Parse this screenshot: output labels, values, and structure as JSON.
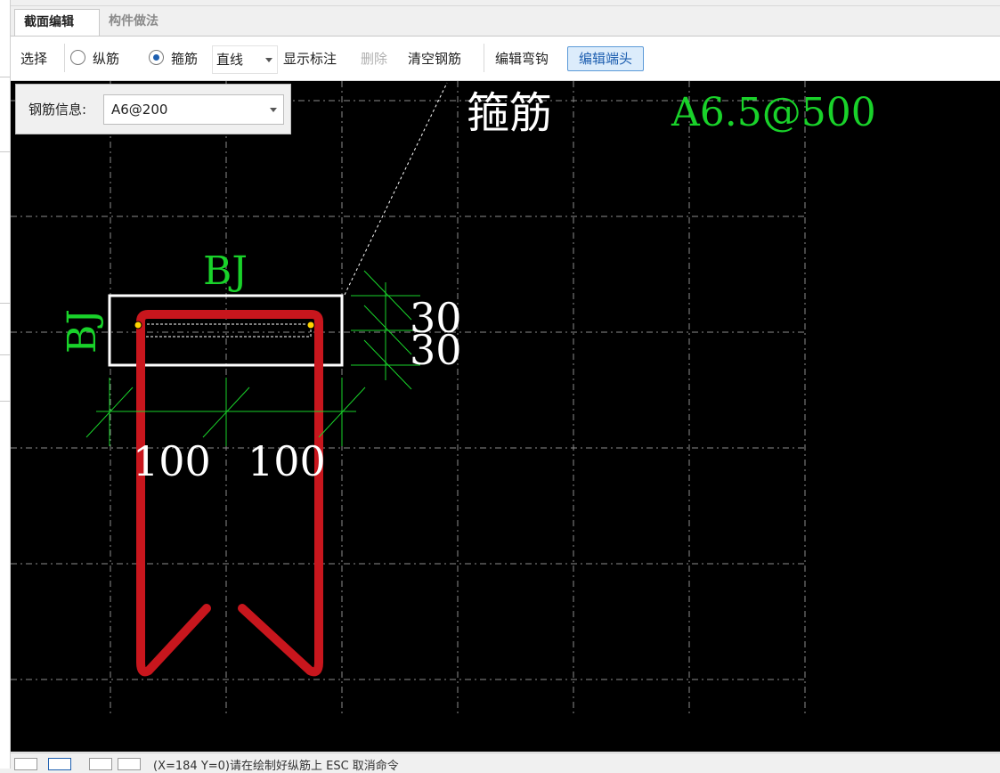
{
  "tabs": {
    "section_edit": "截面编辑",
    "component_method": "构件做法"
  },
  "toolbar": {
    "select": "选择",
    "longitudinal": "纵筋",
    "stirrup": "箍筋",
    "line_type": "直线",
    "show_annotation": "显示标注",
    "delete": "删除",
    "clear_rebar": "清空钢筋",
    "edit_hook": "编辑弯钩",
    "edit_end": "编辑端头",
    "selected_mode": "箍筋"
  },
  "rebar_info": {
    "label": "钢筋信息:",
    "value": "A6@200"
  },
  "drawing": {
    "stirrup_title": "箍筋",
    "stirrup_spec": "A6.5@500",
    "top_label": "BJ",
    "side_label": "BJ",
    "dim_30_a": "30",
    "dim_30_b": "30",
    "dim_100_a": "100",
    "dim_100_b": "100"
  },
  "statusbar": {
    "text": "(X=184 Y=0)请在绘制好纵筋上 ESC 取消命令"
  },
  "colors": {
    "canvas": "#000000",
    "stirrup": "#c8161d",
    "dimension": "#19d22a",
    "text": "#ffffff",
    "grid": "#8c8c8c",
    "accent": "#1e5fb0"
  }
}
